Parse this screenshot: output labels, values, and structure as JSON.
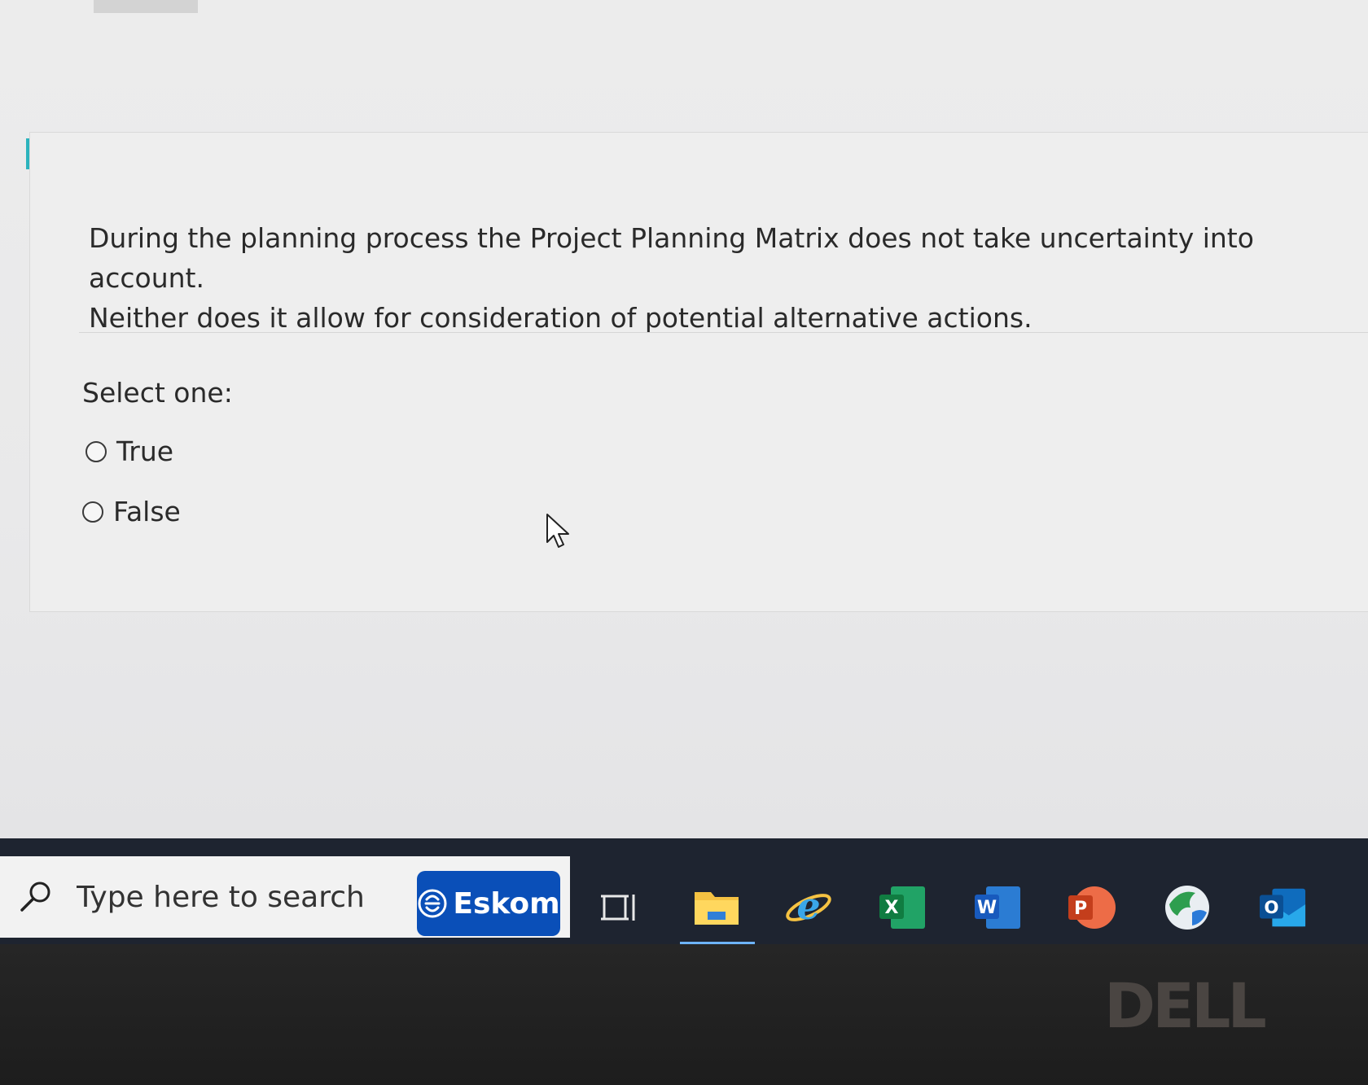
{
  "question": {
    "line1": "During the planning process the Project Planning Matrix does not take uncertainty into account.",
    "line2": "Neither does it allow for consideration of potential alternative actions.",
    "prompt": "Select one:",
    "options": [
      {
        "label": "True",
        "selected": false
      },
      {
        "label": "False",
        "selected": false
      }
    ]
  },
  "taskbar": {
    "search_placeholder": "Type here to search",
    "eskom_label": "Eskom",
    "apps": [
      "task-view",
      "file-explorer",
      "internet-explorer",
      "excel",
      "word",
      "powerpoint",
      "browser",
      "outlook"
    ],
    "excel_letter": "X",
    "word_letter": "W",
    "powerpoint_letter": "P",
    "outlook_letter": "O"
  },
  "brand": {
    "bezel_logo": "DELL"
  },
  "colors": {
    "header_bar": "#2bb3bd",
    "eskom_blue": "#0a4fb8",
    "taskbar": "#1e2430"
  }
}
